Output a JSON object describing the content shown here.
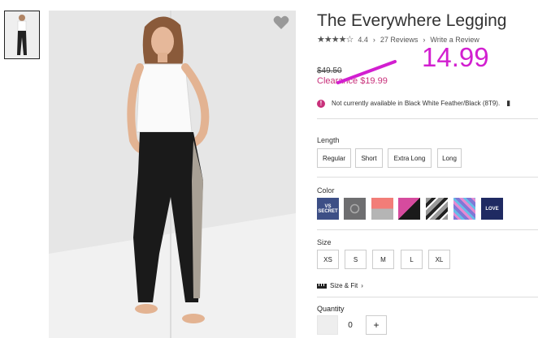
{
  "product": {
    "title": "The Everywhere Legging",
    "rating_value": "4.4",
    "reviews_label": "27 Reviews",
    "write_review_label": "Write a Review",
    "price_original": "$49.50",
    "price_clearance": "Clearance $19.99",
    "annotation_price": "14.99",
    "availability_note": "Not currently available in Black White Feather/Black (8T9).",
    "alert_icon_glyph": "!"
  },
  "length": {
    "label": "Length",
    "options": [
      "Regular",
      "Short",
      "Extra Long",
      "Long"
    ]
  },
  "color": {
    "label": "Color",
    "swatches": [
      {
        "name": "vs-secret-navy",
        "text": "VS SECRET",
        "color": "#3d4f86"
      },
      {
        "name": "charcoal-logo",
        "text": "",
        "color": "#6e6e70"
      },
      {
        "name": "coral-grey",
        "text": "",
        "color": "#f27d78"
      },
      {
        "name": "pink-black",
        "text": "",
        "color": "#d64b9e"
      },
      {
        "name": "grey-black-stripe",
        "text": "",
        "color": "#9a9a9a"
      },
      {
        "name": "purple-print",
        "text": "",
        "color": "#7f78d6"
      },
      {
        "name": "navy-love",
        "text": "LOVE",
        "color": "#1f2a62"
      }
    ]
  },
  "size": {
    "label": "Size",
    "options": [
      "XS",
      "S",
      "M",
      "L",
      "XL"
    ],
    "fit_label": "Size & Fit"
  },
  "quantity": {
    "label": "Quantity",
    "value": "0",
    "plus_label": "+"
  },
  "colors": {
    "accent_pink": "#c8307a",
    "annotation_magenta": "#d21fd0"
  },
  "icons": {
    "heart": "heart-icon",
    "star": "star-icon",
    "chevron": "chevron-right-icon",
    "ruler": "ruler-icon"
  }
}
